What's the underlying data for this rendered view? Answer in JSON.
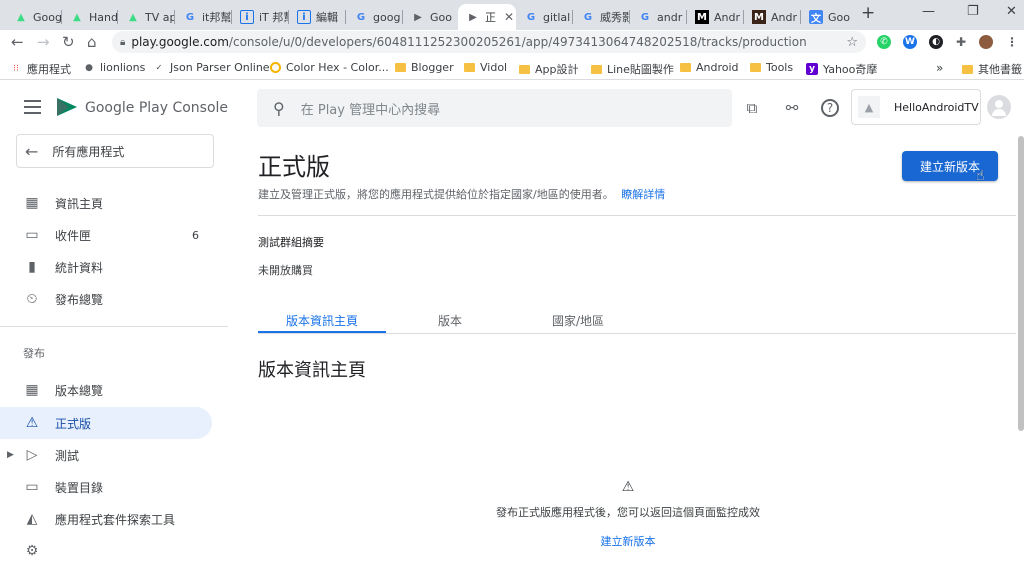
{
  "tabs": [
    {
      "label": "Goog",
      "icon": "android-icon"
    },
    {
      "label": "Hand",
      "icon": "android-icon"
    },
    {
      "label": "TV ap",
      "icon": "android-icon"
    },
    {
      "label": "it邦幫",
      "icon": "google-icon"
    },
    {
      "label": "iT 邦幫",
      "icon": "ithome-icon"
    },
    {
      "label": "編輯",
      "icon": "ithome-icon"
    },
    {
      "label": "goog",
      "icon": "google-icon"
    },
    {
      "label": "Goo",
      "icon": "play-console-icon"
    },
    {
      "label": "正",
      "icon": "play-console-icon"
    },
    {
      "label": "gitlal",
      "icon": "google-icon"
    },
    {
      "label": "威秀影",
      "icon": "google-icon"
    },
    {
      "label": "andr",
      "icon": "google-icon"
    },
    {
      "label": "Andr",
      "icon": "medium-icon"
    },
    {
      "label": "Andr",
      "icon": "medium-icon"
    },
    {
      "label": "Goo",
      "icon": "translate-icon"
    }
  ],
  "address": {
    "host": "play.google.com",
    "path": "/console/u/0/developers/6048111252300205261/app/4973413064748202518/tracks/production"
  },
  "bookmarks": [
    {
      "label": "應用程式",
      "icon": "apps-grid-icon"
    },
    {
      "label": "lionlions",
      "icon": "globe-icon"
    },
    {
      "label": "Json Parser Online",
      "icon": "json-icon"
    },
    {
      "label": "Color Hex - Color...",
      "icon": "colorhex-icon"
    },
    {
      "label": "Blogger",
      "icon": "folder-icon"
    },
    {
      "label": "Vidol",
      "icon": "folder-icon"
    },
    {
      "label": "App設計",
      "icon": "folder-icon"
    },
    {
      "label": "Line貼圖製作",
      "icon": "folder-icon"
    },
    {
      "label": "Android",
      "icon": "folder-icon"
    },
    {
      "label": "Tools",
      "icon": "folder-icon"
    },
    {
      "label": "Yahoo奇摩",
      "icon": "yahoo-icon"
    },
    {
      "label": "»",
      "icon": ""
    },
    {
      "label": "其他書籤",
      "icon": "folder-icon"
    }
  ],
  "app": {
    "brand": "Google Play Console",
    "search_placeholder": "在 Play 管理中心內搜尋",
    "account_name": "HelloAndroidTV"
  },
  "sidebar": {
    "back_label": "所有應用程式",
    "items": [
      {
        "label": "資訊主頁",
        "icon": "dashboard-icon",
        "badge": ""
      },
      {
        "label": "收件匣",
        "icon": "inbox-icon",
        "badge": "6"
      },
      {
        "label": "統計資料",
        "icon": "bar-chart-icon",
        "badge": ""
      },
      {
        "label": "發布總覽",
        "icon": "publishing-overview-icon",
        "badge": ""
      }
    ],
    "section_label": "發布",
    "release_items": [
      {
        "label": "版本總覽",
        "icon": "release-overview-icon"
      },
      {
        "label": "正式版",
        "icon": "production-icon"
      },
      {
        "label": "測試",
        "icon": "testing-icon"
      },
      {
        "label": "裝置目錄",
        "icon": "devices-icon"
      },
      {
        "label": "應用程式套件探索工具",
        "icon": "bundle-explorer-icon"
      }
    ]
  },
  "main": {
    "title": "正式版",
    "description": "建立及管理正式版，將您的應用程式提供給位於指定國家/地區的使用者。",
    "learn_more": "瞭解詳情",
    "create_button": "建立新版本",
    "test_group_summary": "測試群組摘要",
    "not_open": "未開放購買",
    "tabs": [
      "版本資訊主頁",
      "版本",
      "國家/地區"
    ],
    "section_title": "版本資訊主頁",
    "empty_message": "發布正式版應用程式後，您可以返回這個頁面監控成效",
    "empty_link": "建立新版本"
  },
  "colors": {
    "accent": "#1a73e8",
    "button": "#1967d2",
    "active_bg": "#e8f0fe"
  }
}
